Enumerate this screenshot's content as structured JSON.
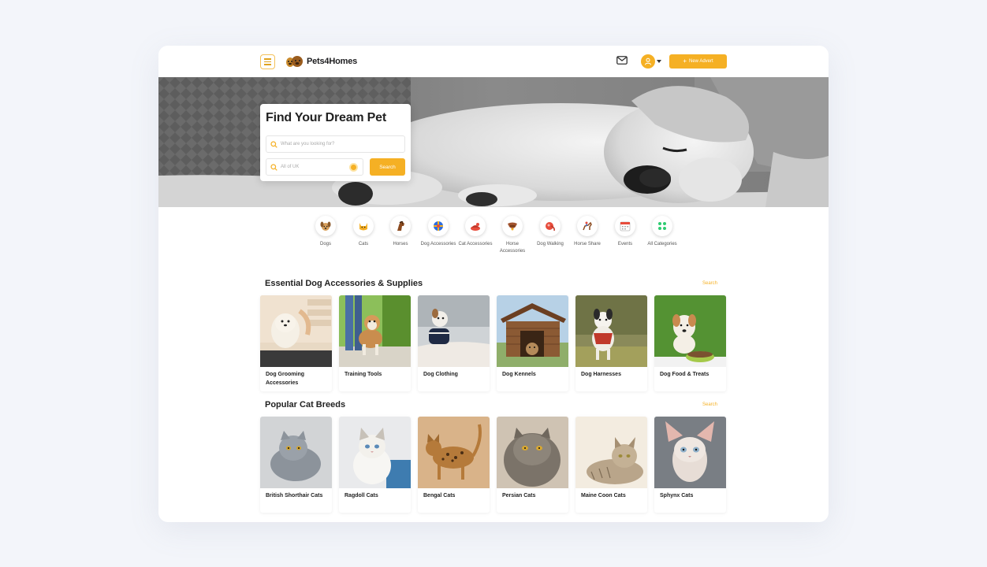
{
  "header": {
    "logo_text": "Pets4Homes",
    "new_advert_label": "New Advert",
    "new_advert_icon": "plus-icon",
    "mail_icon": "mail-icon",
    "avatar_icon": "user-icon"
  },
  "hero": {
    "title": "Find Your Dream Pet",
    "search_placeholder": "What are you looking for?",
    "location_placeholder": "All of UK",
    "search_button": "Search"
  },
  "categories": [
    {
      "label": "Dogs",
      "icon": "dog-icon"
    },
    {
      "label": "Cats",
      "icon": "cat-icon"
    },
    {
      "label": "Horses",
      "icon": "horse-icon"
    },
    {
      "label": "Dog Accessories",
      "icon": "dog-accessories-icon"
    },
    {
      "label": "Cat Accessories",
      "icon": "cat-accessories-icon"
    },
    {
      "label": "Horse Accessories",
      "icon": "horse-accessories-icon"
    },
    {
      "label": "Dog Walking",
      "icon": "dog-walking-icon"
    },
    {
      "label": "Horse Share",
      "icon": "horse-share-icon"
    },
    {
      "label": "Events",
      "icon": "calendar-icon"
    },
    {
      "label": "All Categories",
      "icon": "grid-icon"
    }
  ],
  "dog_section": {
    "title": "Essential Dog Accessories & Supplies",
    "link": "Search",
    "items": [
      {
        "label": "Dog Grooming Accessories"
      },
      {
        "label": "Training Tools"
      },
      {
        "label": "Dog Clothing"
      },
      {
        "label": "Dog Kennels"
      },
      {
        "label": "Dog Harnesses"
      },
      {
        "label": "Dog Food & Treats"
      }
    ]
  },
  "cat_section": {
    "title": "Popular Cat Breeds",
    "link": "Search",
    "items": [
      {
        "label": "British Shorthair Cats"
      },
      {
        "label": "Ragdoll Cats"
      },
      {
        "label": "Bengal Cats"
      },
      {
        "label": "Persian Cats"
      },
      {
        "label": "Maine Coon Cats"
      },
      {
        "label": "Sphynx Cats"
      }
    ]
  },
  "colors": {
    "accent": "#f5b024",
    "background": "#f3f5fa",
    "text": "#222222"
  }
}
